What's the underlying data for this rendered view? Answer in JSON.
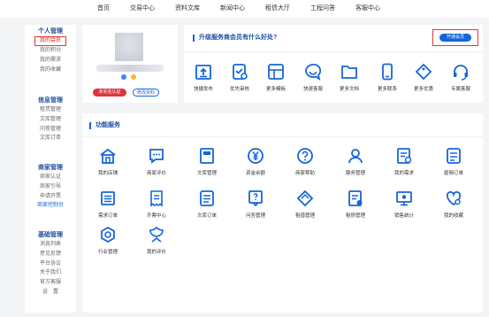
{
  "topnav": [
    "首页",
    "交易中心",
    "资料文库",
    "新闻中心",
    "租债大厅",
    "工程问答",
    "客服中心"
  ],
  "sidebar": {
    "groups": [
      {
        "title": "个人管理",
        "items": [
          {
            "label": "我的会员",
            "active": true
          },
          {
            "label": "我的积分"
          },
          {
            "label": "我的需求"
          },
          {
            "label": "我的收藏"
          }
        ]
      },
      {
        "title": "信息管理",
        "items": [
          {
            "label": "租赁管理"
          },
          {
            "label": "文库管理"
          },
          {
            "label": "问答管理"
          },
          {
            "label": "文库订单"
          }
        ]
      },
      {
        "title": "商家管理",
        "items": [
          {
            "label": "商家认证"
          },
          {
            "label": "商家引导"
          },
          {
            "label": "申请开票"
          },
          {
            "label": "商家控制台",
            "blue": true
          }
        ]
      },
      {
        "title": "基础管理",
        "items": [
          {
            "label": "消息列表"
          },
          {
            "label": "意见反馈"
          },
          {
            "label": "平台协议"
          },
          {
            "label": "关于我们"
          },
          {
            "label": "官方客服"
          },
          {
            "label": "设　置"
          }
        ]
      }
    ]
  },
  "profile": {
    "cert_button": "未实名认证",
    "edit_button": "修改资料"
  },
  "upgrade": {
    "title": "升级服务商会员有什么好处?",
    "button": "开通会员",
    "features": [
      {
        "label": "快捷发布",
        "icon": "upload-doc-icon"
      },
      {
        "label": "优先审核",
        "icon": "review-icon"
      },
      {
        "label": "更多模板",
        "icon": "templates-icon"
      },
      {
        "label": "快速客服",
        "icon": "chat-icon"
      },
      {
        "label": "更多文档",
        "icon": "folder-icon"
      },
      {
        "label": "更多联系",
        "icon": "phone-icon"
      },
      {
        "label": "更多优惠",
        "icon": "coupon-icon"
      },
      {
        "label": "专属客服",
        "icon": "headset-icon"
      }
    ]
  },
  "services": {
    "title": "功能服务",
    "items": [
      {
        "label": "我的店铺",
        "icon": "store-icon"
      },
      {
        "label": "商家评价",
        "icon": "review-bubble-icon"
      },
      {
        "label": "文库管理",
        "icon": "library-icon"
      },
      {
        "label": "资金余额",
        "icon": "money-icon"
      },
      {
        "label": "商家帮助",
        "icon": "help-icon"
      },
      {
        "label": "服务管理",
        "icon": "service-manage-icon"
      },
      {
        "label": "我的需求",
        "icon": "demand-icon"
      },
      {
        "label": "雇佣订单",
        "icon": "hire-order-icon"
      },
      {
        "label": "需求订单",
        "icon": "demand-order-icon"
      },
      {
        "label": "开票中心",
        "icon": "invoice-icon"
      },
      {
        "label": "文库订单",
        "icon": "library-order-icon"
      },
      {
        "label": "问答管理",
        "icon": "qa-icon"
      },
      {
        "label": "租借管理",
        "icon": "lease-icon"
      },
      {
        "label": "租债管理",
        "icon": "debt-icon"
      },
      {
        "label": "销售统计",
        "icon": "sales-stats-icon"
      },
      {
        "label": "我的收藏",
        "icon": "favorite-icon"
      },
      {
        "label": "行业管理",
        "icon": "industry-icon"
      },
      {
        "label": "我的评价",
        "icon": "my-review-icon"
      }
    ]
  },
  "colors": {
    "brand": "#1565d8",
    "title": "#1e4fa3",
    "alert": "#d9363e"
  }
}
